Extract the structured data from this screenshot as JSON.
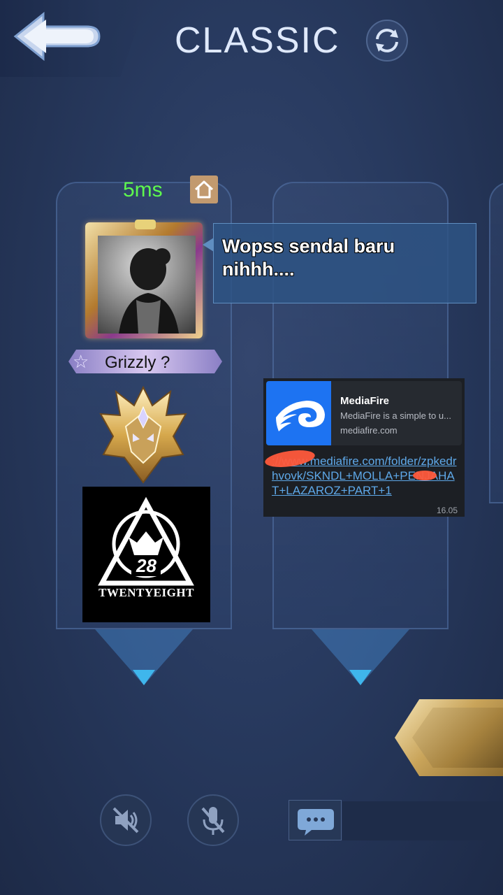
{
  "header": {
    "title": "CLASSIC",
    "back_icon": "back-arrow-icon",
    "refresh_icon": "refresh-icon"
  },
  "player": {
    "ping": "5ms",
    "ping_color": "#5ef84e",
    "home_icon": "home-icon",
    "name": "Grizzly ?",
    "star_glyph": "☆",
    "rank_icon": "mythic-rank-emblem-icon",
    "squad_logo": {
      "number": "28",
      "name": "TWENTYEIGHT"
    }
  },
  "chat": {
    "message": "Wopss sendal baru nihhh...."
  },
  "link_card": {
    "title": "MediaFire",
    "description": "MediaFire is a simple to u...",
    "domain": "mediafire.com",
    "url": "://www.mediafire.com/folder/zpkedrhvovk/SKNDL+MOLLA+PENJAHAT+LAZAROZ+PART+1",
    "time": "16.05"
  },
  "controls": {
    "speaker_icon": "speaker-muted-icon",
    "mic_icon": "mic-muted-icon",
    "chat_icon": "chat-bubble-icon"
  }
}
